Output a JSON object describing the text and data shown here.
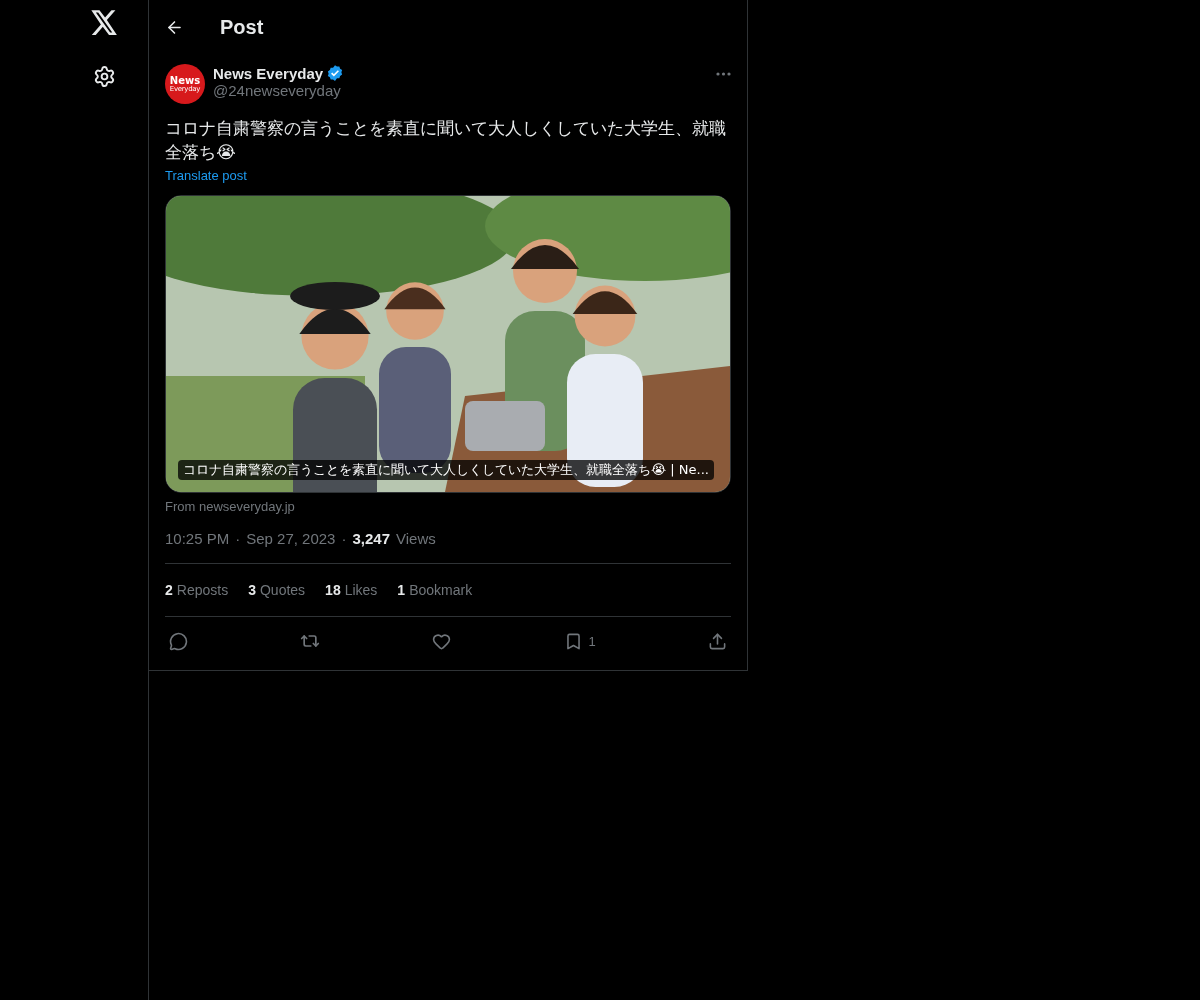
{
  "header": {
    "title": "Post"
  },
  "post": {
    "author": {
      "name": "News Everyday",
      "handle": "@24newseveryday",
      "verified": true,
      "avatar_text": [
        "News",
        "Everyday"
      ]
    },
    "text": "コロナ自粛警察の言うことを素直に聞いて大人しくしていた大学生、就職全落ち😭",
    "translate_link": "Translate post",
    "card": {
      "caption": "コロナ自粛警察の言うことを素直に聞いて大人しくしていた大学生、就職全落ち😭 | Ne...",
      "source": "From newseveryday.jp"
    },
    "meta": {
      "time": "10:25 PM",
      "separator": "·",
      "date": "Sep 27, 2023",
      "views_count": "3,247",
      "views_label": "Views"
    },
    "stats": [
      {
        "count": "2",
        "label": "Reposts"
      },
      {
        "count": "3",
        "label": "Quotes"
      },
      {
        "count": "18",
        "label": "Likes"
      },
      {
        "count": "1",
        "label": "Bookmark"
      }
    ],
    "actions": [
      {
        "kind": "reply"
      },
      {
        "kind": "repost"
      },
      {
        "kind": "like"
      },
      {
        "kind": "bookmark",
        "count": "1"
      },
      {
        "kind": "share"
      }
    ]
  }
}
